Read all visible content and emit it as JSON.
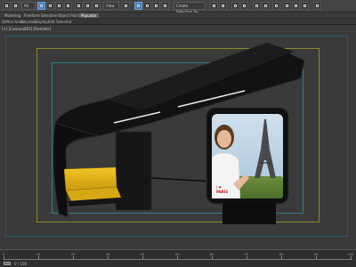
{
  "toolbar": {
    "undo_label": "Undo",
    "redo_label": "Redo",
    "selection_filter": "All",
    "reference_coord": "View",
    "named_selection": "Create Selection Se"
  },
  "ribbon": {
    "tabs": [
      "Modeling",
      "Freeform",
      "Selection",
      "Object Paint",
      "Populate"
    ],
    "active": "Populate"
  },
  "subbar": {
    "items": [
      "Define Areas",
      "Simulate",
      "Display",
      "Edit Selected"
    ]
  },
  "viewport": {
    "label": "[+] [Camera001] [Realistic]"
  },
  "poster": {
    "tshirt_text_top": "I ❤",
    "tshirt_text_bottom": "PARIS"
  },
  "timeline": {
    "ticks": [
      0,
      10,
      20,
      30,
      40,
      50,
      60,
      70,
      80,
      90,
      100
    ],
    "current_frame": "0 / 100"
  },
  "colors": {
    "bench": "#e8b817",
    "accent": "#4a7fbf",
    "shelter": "#141414"
  }
}
